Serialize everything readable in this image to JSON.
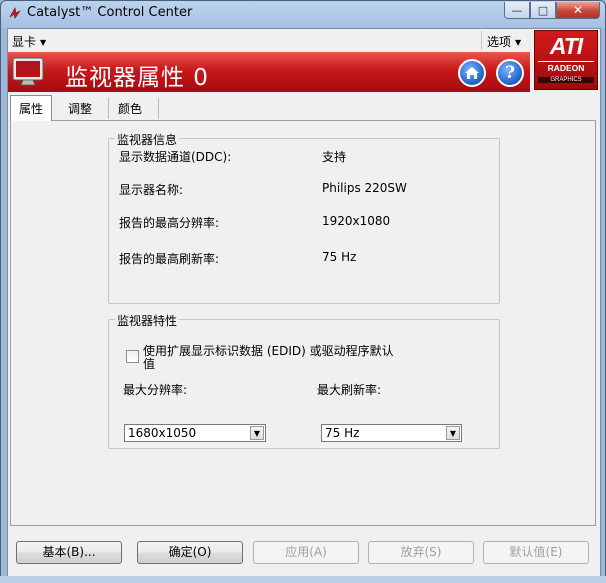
{
  "window": {
    "title": "Catalyst™ Control Center",
    "controls": {
      "minimize": "—",
      "maximize": "□",
      "close": "✕"
    }
  },
  "menubar": {
    "left_menu": "显卡",
    "right_menu": "选项"
  },
  "banner": {
    "title": "监视器属性 0",
    "home_icon": "home-icon",
    "help_icon": "help-icon",
    "help_glyph": "?"
  },
  "logo": {
    "brand": "ATI",
    "line1": "RADEON",
    "line2": "GRAPHICS"
  },
  "tabs": [
    {
      "label": "属性",
      "active": true
    },
    {
      "label": "调整",
      "active": false
    },
    {
      "label": "颜色",
      "active": false
    }
  ],
  "monitor_info": {
    "title": "监视器信息",
    "rows": [
      {
        "label": "显示数据通道(DDC):",
        "value": "支持"
      },
      {
        "label": "显示器名称:",
        "value": "Philips 220SW"
      },
      {
        "label": "报告的最高分辨率:",
        "value": "1920x1080"
      },
      {
        "label": "报告的最高刷新率:",
        "value": "75 Hz"
      }
    ]
  },
  "monitor_props": {
    "title": "监视器特性",
    "edid_checkbox_line1": "使用扩展显示标识数据 (EDID) 或驱动程序默认",
    "edid_checkbox_line2": "值",
    "edid_checked": false,
    "max_resolution_label": "最大分辨率:",
    "max_resolution_value": "1680x1050",
    "max_refresh_label": "最大刷新率:",
    "max_refresh_value": "75 Hz"
  },
  "footer": {
    "basic": "基本(B)...",
    "ok": "确定(O)",
    "apply": "应用(A)",
    "discard": "放弃(S)",
    "defaults": "默认值(E)"
  },
  "colors": {
    "banner_red": "#c9181a",
    "title_bar": "#a7c1e2",
    "panel_bg": "#f0f0f0"
  }
}
